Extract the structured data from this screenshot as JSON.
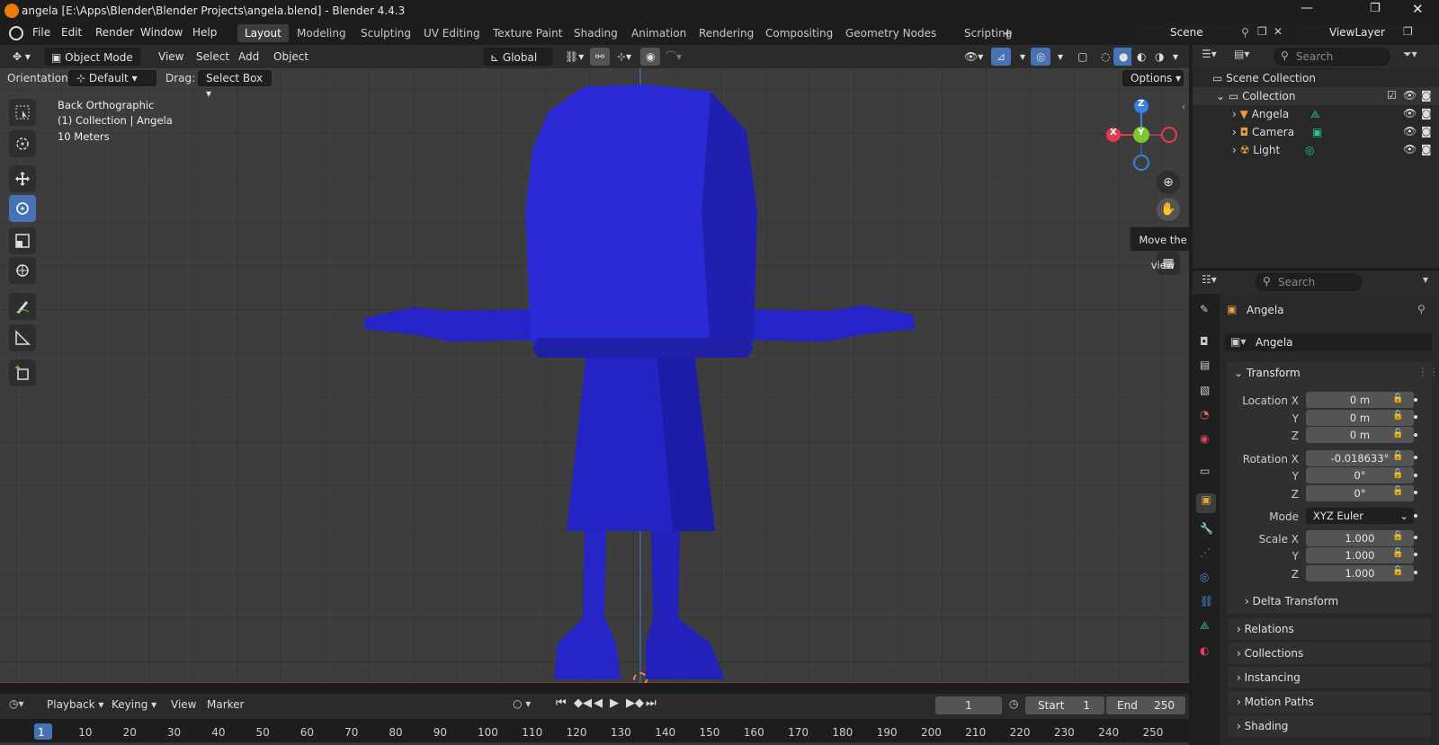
{
  "window": {
    "title": "angela [E:\\Apps\\Blender\\Blender Projects\\angela.blend] - Blender 4.4.3"
  },
  "menu": [
    "File",
    "Edit",
    "Render",
    "Window",
    "Help"
  ],
  "workspaces": [
    "Layout",
    "Modeling",
    "Sculpting",
    "UV Editing",
    "Texture Paint",
    "Shading",
    "Animation",
    "Rendering",
    "Compositing",
    "Geometry Nodes",
    "Scripting"
  ],
  "scene": {
    "label": "Scene",
    "viewlayer": "ViewLayer"
  },
  "viewport_header": {
    "mode": "Object Mode",
    "menus": [
      "View",
      "Select",
      "Add",
      "Object"
    ],
    "transform": "Global",
    "orientation_label": "Orientation:",
    "orientation_value": "Default",
    "drag_label": "Drag:",
    "drag_value": "Select Box",
    "options": "Options"
  },
  "viewport_info": {
    "view": "Back Orthographic",
    "collection": "(1) Collection | Angela",
    "scale": "10 Meters"
  },
  "gizmo": {
    "x": "X",
    "y": "Y",
    "z": "Z"
  },
  "tooltip": "Move the view",
  "outliner": {
    "search_placeholder": "Search",
    "root": "Scene Collection",
    "collection": "Collection",
    "items": [
      "Angela",
      "Camera",
      "Light"
    ]
  },
  "properties": {
    "search_placeholder": "Search",
    "object_name": "Angela",
    "data_name": "Angela",
    "transform_title": "Transform",
    "location_label": "Location X",
    "rotation_label": "Rotation X",
    "scale_label": "Scale X",
    "y": "Y",
    "z": "Z",
    "location": [
      "0 m",
      "0 m",
      "0 m"
    ],
    "rotation": [
      "-0.018633°",
      "0°",
      "0°"
    ],
    "mode_label": "Mode",
    "mode_value": "XYZ Euler",
    "scale": [
      "1.000",
      "1.000",
      "1.000"
    ],
    "delta": "Delta Transform",
    "panels": [
      "Relations",
      "Collections",
      "Instancing",
      "Motion Paths",
      "Shading"
    ]
  },
  "timeline": {
    "menus": [
      "Playback",
      "Keying",
      "View",
      "Marker"
    ],
    "current_frame": "1",
    "start_label": "Start",
    "start": "1",
    "end_label": "End",
    "end": "250",
    "ruler": [
      "1",
      "10",
      "20",
      "30",
      "40",
      "50",
      "60",
      "70",
      "80",
      "90",
      "100",
      "110",
      "120",
      "130",
      "140",
      "150",
      "160",
      "170",
      "180",
      "190",
      "200",
      "210",
      "220",
      "230",
      "240",
      "250"
    ]
  },
  "colors": {
    "accent": "#4772b3",
    "model": "#2a2ad6",
    "axis_x": "#e03c4e",
    "axis_y": "#7cc82c",
    "axis_z": "#3a82e0"
  }
}
